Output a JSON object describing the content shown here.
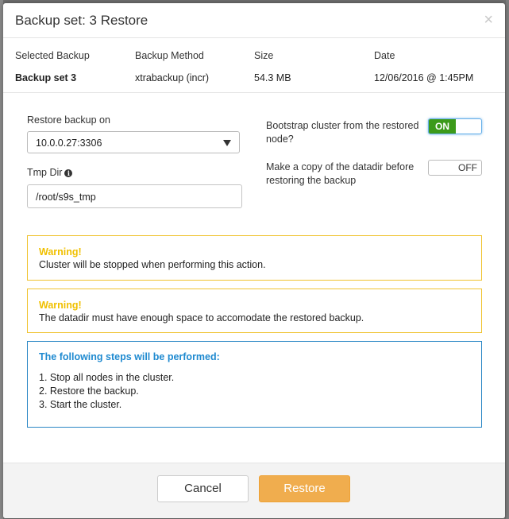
{
  "dialog": {
    "title": "Backup set: 3 Restore",
    "close_glyph": "×"
  },
  "summary": {
    "headers": [
      "Selected Backup",
      "Backup Method",
      "Size",
      "Date"
    ],
    "values": [
      "Backup set 3",
      "xtrabackup (incr)",
      "54.3 MB",
      "12/06/2016 @ 1:45PM"
    ]
  },
  "form": {
    "restore_on_label": "Restore backup on",
    "restore_on_value": "10.0.0.27:3306",
    "tmp_dir_label": "Tmp Dir",
    "tmp_dir_value": "/root/s9s_tmp",
    "bootstrap_label": "Bootstrap cluster from the restored node?",
    "bootstrap_state": "ON",
    "copy_datadir_label": "Make a copy of the datadir before restoring the backup",
    "copy_datadir_state": "OFF"
  },
  "alerts": [
    {
      "title": "Warning!",
      "text": "Cluster will be stopped when performing this action."
    },
    {
      "title": "Warning!",
      "text": "The datadir must have enough space to accomodate the restored backup."
    }
  ],
  "steps": {
    "title": "The following steps will be performed:",
    "items": [
      "1. Stop all nodes in the cluster.",
      "2. Restore the backup.",
      "3. Start the cluster."
    ]
  },
  "footer": {
    "cancel_label": "Cancel",
    "restore_label": "Restore"
  },
  "colors": {
    "warning": "#f0c000",
    "info": "#1f8ad0",
    "toggle_on": "#3c9a1a",
    "restore_button": "#f0ad4e"
  }
}
